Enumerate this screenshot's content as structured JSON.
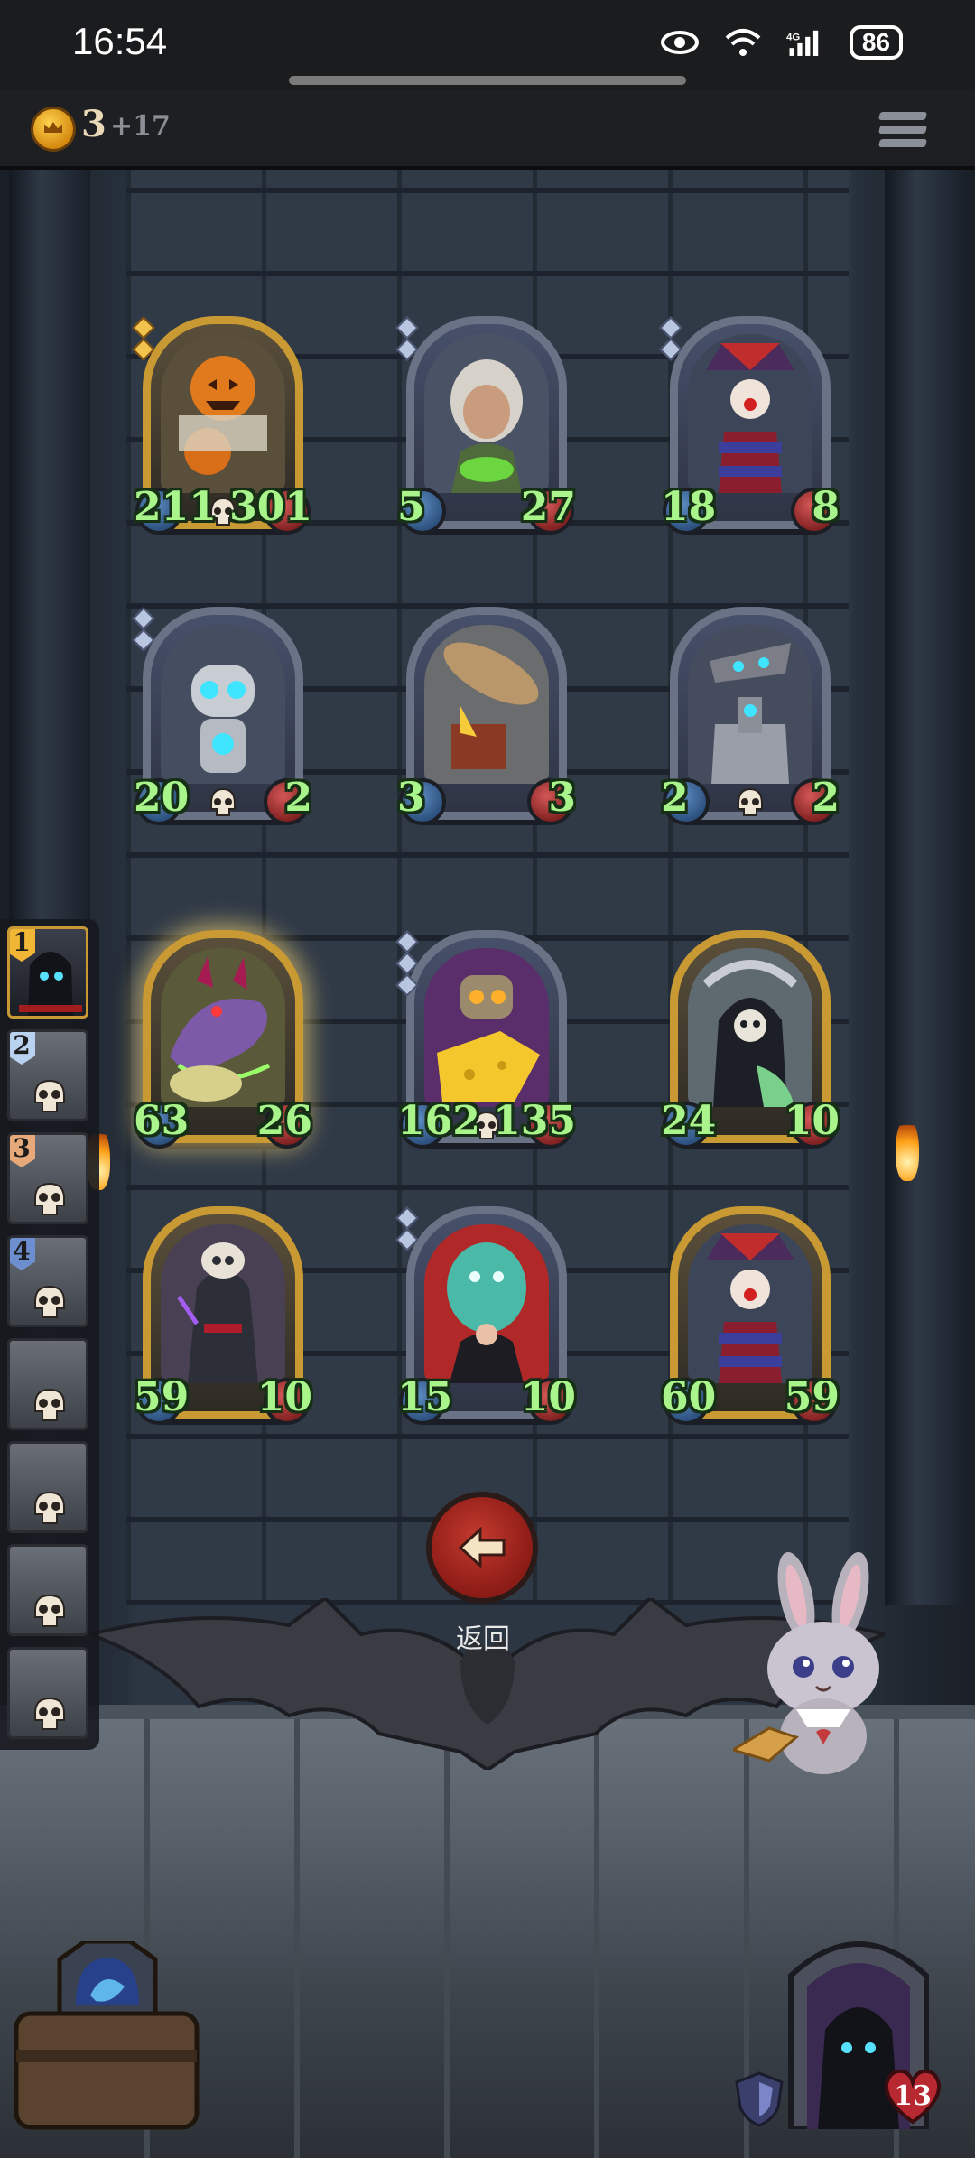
{
  "status_bar": {
    "time": "16:54",
    "battery": "86",
    "icons": [
      "eye-icon",
      "wifi-icon",
      "signal-4g-icon",
      "battery-icon"
    ]
  },
  "hud": {
    "gold": "3",
    "gold_income": "+17",
    "menu_icon": "hamburger-menu-icon"
  },
  "board": {
    "cards": [
      {
        "name": "pumpkin-scarecrow-card",
        "attack": "211",
        "health": "301",
        "golden": true,
        "tier_pips": 2
      },
      {
        "name": "old-witch-card",
        "attack": "5",
        "health": "27",
        "golden": false,
        "tier_pips": 2
      },
      {
        "name": "jester-clown-card",
        "attack": "18",
        "health": "8",
        "golden": false,
        "tier_pips": 2
      },
      {
        "name": "robot-automaton-card",
        "attack": "20",
        "health": "2",
        "golden": false,
        "tier_pips": 2
      },
      {
        "name": "airship-card",
        "attack": "3",
        "health": "3",
        "golden": false,
        "tier_pips": 0
      },
      {
        "name": "bell-robot-card",
        "attack": "2",
        "health": "2",
        "golden": false,
        "tier_pips": 0
      },
      {
        "name": "dragon-serpent-card",
        "attack": "63",
        "health": "26",
        "golden": true,
        "tier_pips": 0
      },
      {
        "name": "cheese-robot-card",
        "attack": "162",
        "health": "135",
        "golden": false,
        "tier_pips": 3
      },
      {
        "name": "grim-reaper-card",
        "attack": "24",
        "health": "10",
        "golden": true,
        "tier_pips": 0
      },
      {
        "name": "dark-sorcerer-card",
        "attack": "59",
        "health": "10",
        "golden": true,
        "tier_pips": 0
      },
      {
        "name": "ghost-summoner-card",
        "attack": "15",
        "health": "10",
        "golden": false,
        "tier_pips": 2
      },
      {
        "name": "golden-jester-card",
        "attack": "60",
        "health": "59",
        "golden": true,
        "tier_pips": 0
      }
    ],
    "return_label": "返回"
  },
  "roster": {
    "ranks": [
      "1",
      "2",
      "3",
      "4"
    ]
  },
  "player": {
    "hero_health": "13"
  },
  "colors": {
    "stat_text": "#a9f58c",
    "gold_frame": "#c99a33",
    "silver_frame": "#6a7286",
    "return_red": "#c43a2e"
  }
}
